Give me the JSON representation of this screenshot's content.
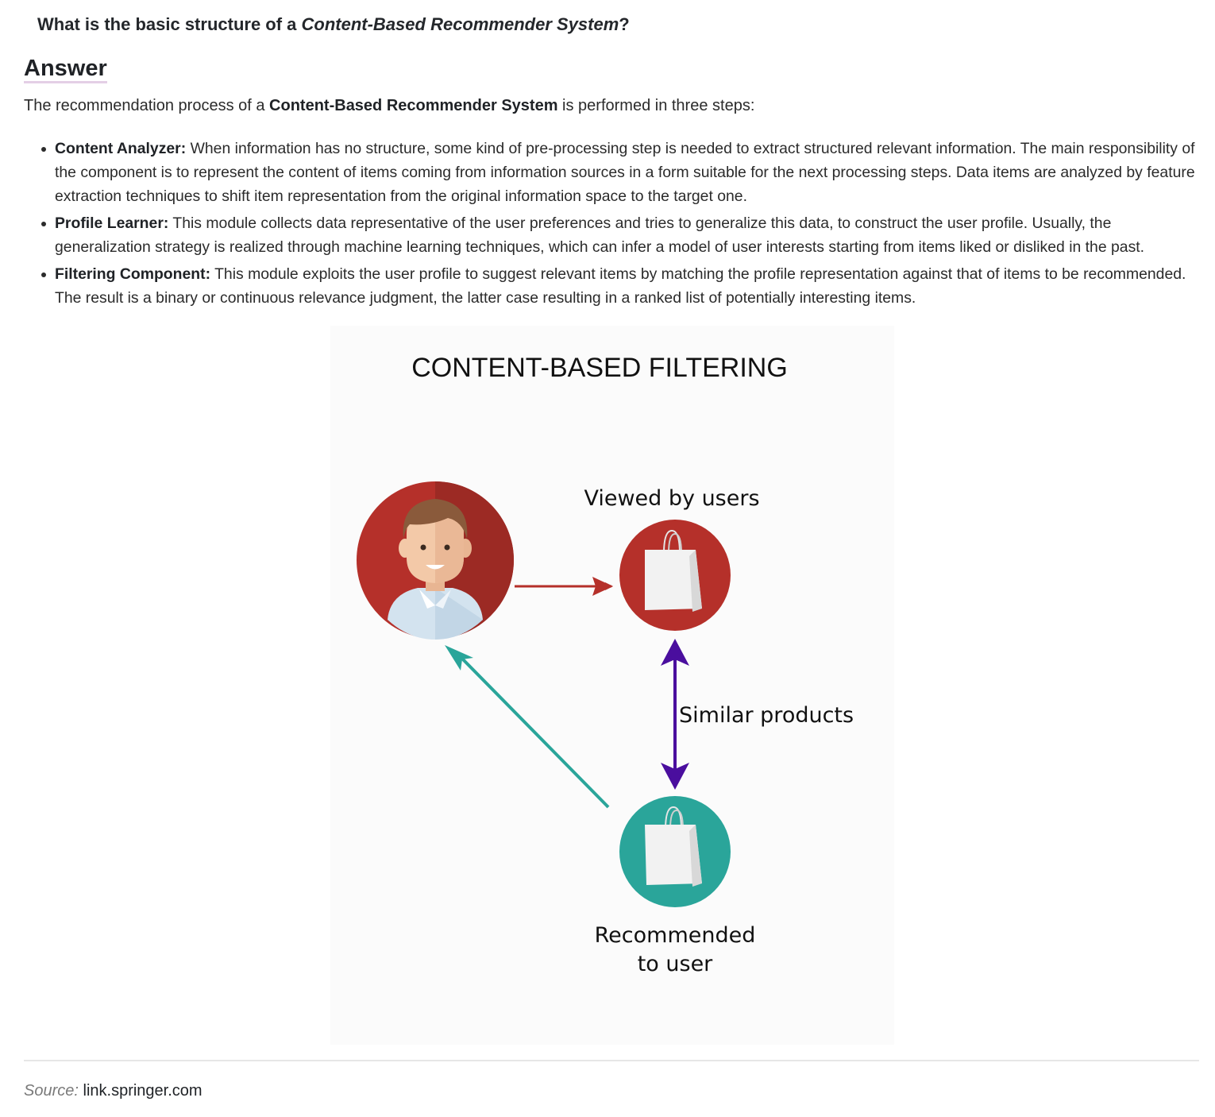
{
  "question": {
    "prefix": "What is the basic structure of a ",
    "emphasis": "Content-Based Recommender System",
    "suffix": "?"
  },
  "answer_heading": "Answer",
  "intro": {
    "prefix": "The recommendation process of a ",
    "bold": "Content-Based Recommender System",
    "suffix": " is performed in three steps:"
  },
  "steps": [
    {
      "term": "Content Analyzer:",
      "text": " When information has no structure, some kind of pre-processing step is needed to extract structured relevant information. The main responsibility of the component is to represent the content of items coming from information sources in a form suitable for the next processing steps. Data items are analyzed by feature extraction techniques to shift item representation from the original information space to the target one."
    },
    {
      "term": "Profile Learner:",
      "text": " This module collects data representative of the user preferences and tries to generalize this data, to construct the user profile. Usually, the generalization strategy is realized through machine learning techniques, which can infer a model of user interests starting from items liked or disliked in the past."
    },
    {
      "term": "Filtering Component:",
      "text": " This module exploits the user profile to suggest relevant items by matching the profile representation against that of items to be recommended. The result is a binary or continuous relevance judgment, the latter case resulting in a ranked list of potentially interesting items."
    }
  ],
  "diagram": {
    "title": "CONTENT-BASED FILTERING",
    "viewed_label": "Viewed by users",
    "similar_label": "Similar products",
    "recommended_line1": "Recommended",
    "recommended_line2": "to user",
    "colors": {
      "red": "#b5302a",
      "red_dark": "#9c2a24",
      "teal": "#2aa59a",
      "purple": "#4a0e9e",
      "skin": "#f3c9a8",
      "hair": "#8a5a3b",
      "shirt": "#d3e3ef"
    }
  },
  "source": {
    "label": "Source:",
    "value": "link.springer.com"
  }
}
